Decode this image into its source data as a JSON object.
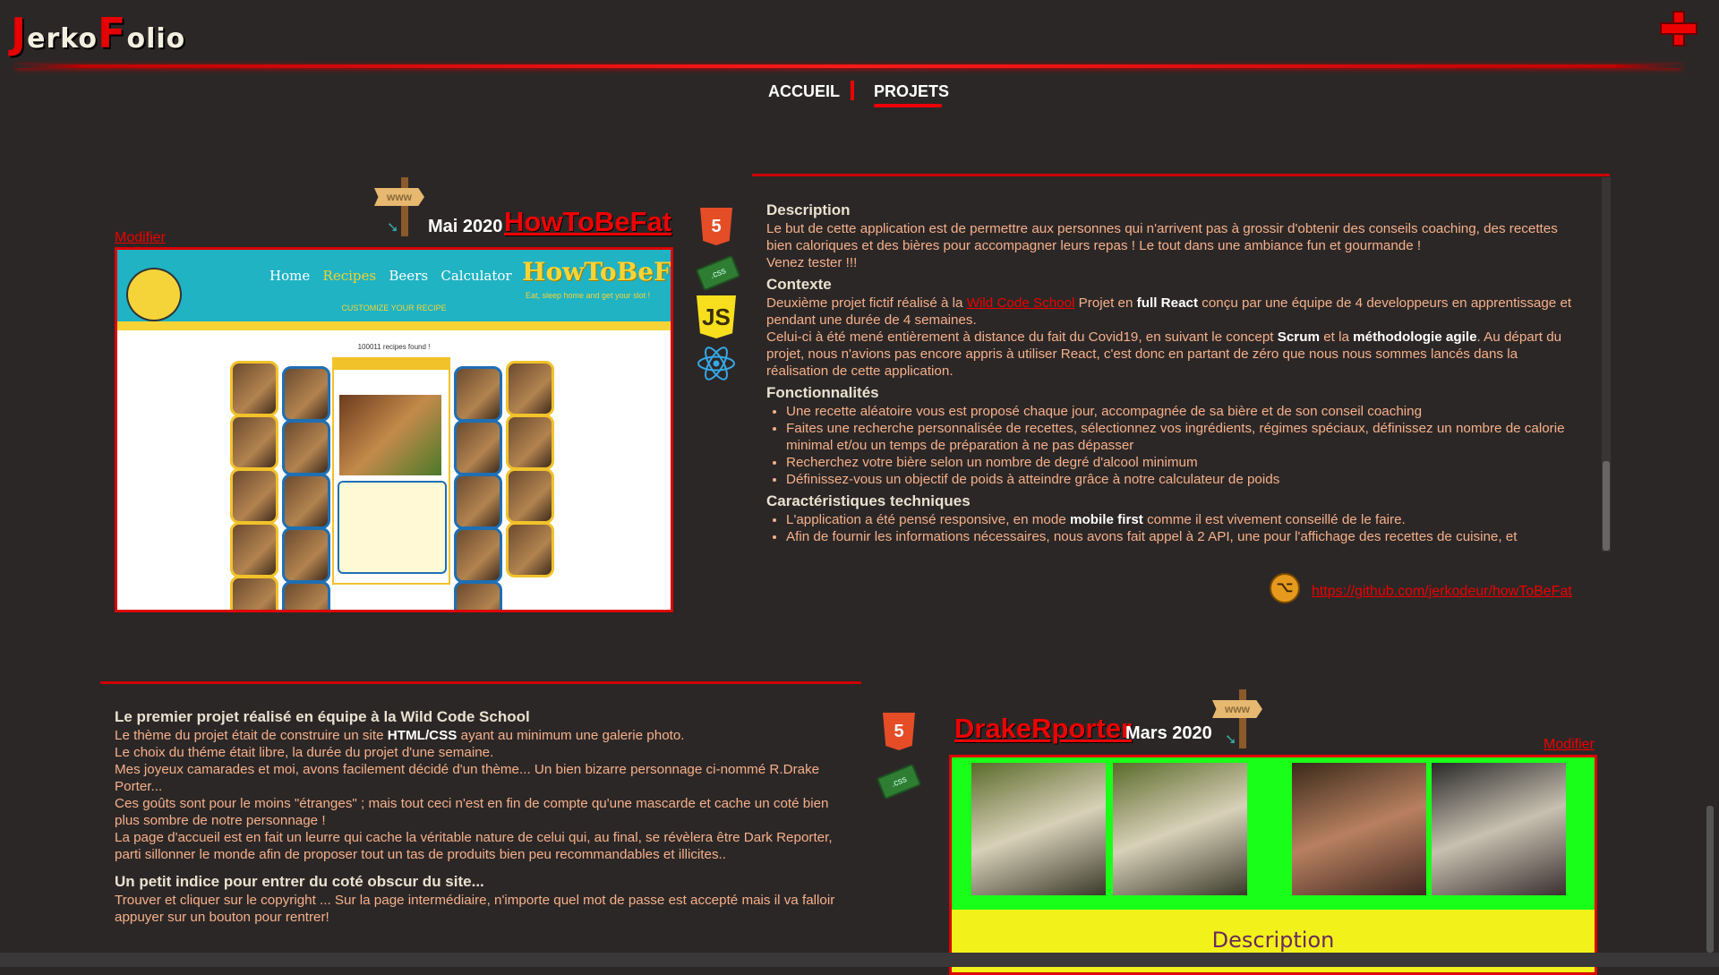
{
  "header": {
    "logo_j": "J",
    "logo_erko": "erko",
    "logo_f": "F",
    "logo_olio": "olio"
  },
  "nav": {
    "home": "ACCUEIL",
    "projects": "PROJETS"
  },
  "colors": {
    "accent": "#e00000",
    "background": "#2c2727",
    "text_orange": "#f4b08a"
  },
  "sign_text": "www",
  "project1": {
    "date": "Mai 2020",
    "title": "HowToBeFat",
    "edit_label": "Modifier",
    "screenshot": {
      "menu": [
        "Home",
        "Recipes",
        "Beers",
        "Calculator"
      ],
      "brand": "HowToBeFat",
      "tagline": "Eat, sleep home and get your slot !",
      "banner_text": "CUSTOMIZE YOUR RECIPE",
      "found": "100011 recipes found !"
    },
    "tech_icons": [
      "html5-icon",
      "css3-icon",
      "javascript-icon",
      "react-icon"
    ],
    "sections": {
      "desc_title": "Description",
      "desc_text": "Le but de cette application est de permettre aux personnes qui n'arrivent pas à grossir d'obtenir des conseils coaching, des recettes bien caloriques et des bières pour accompagner leurs repas ! Le tout dans une ambiance fun et gourmande !",
      "desc_text2": "Venez tester !!!",
      "context_title": "Contexte",
      "context_a": "Deuxième projet fictif réalisé à la ",
      "context_link": "Wild Code School",
      "context_b": " Projet en ",
      "context_bold": "full React",
      "context_c": " conçu par une équipe de 4 developpeurs en apprentissage et pendant une durée de 4 semaines.",
      "context2_a": "Celui-ci à été mené entièrement à distance du fait du Covid19, en suivant le concept ",
      "context2_bold1": "Scrum",
      "context2_b": " et la ",
      "context2_bold2": "méthodologie agile",
      "context2_c": ". Au départ du projet, nous n'avions pas encore appris à utiliser React, c'est donc en partant de zéro que nous nous sommes lancés dans la réalisation de cette application.",
      "features_title": "Fonctionnalités",
      "features": [
        "Une recette aléatoire vous est proposé chaque jour, accompagnée de sa bière et de son conseil coaching",
        "Faites une recherche personnalisée de recettes, sélectionnez vos ingrédients, régimes spéciaux, définissez un nombre de calorie minimal et/ou un temps de préparation à ne pas dépasser",
        "Recherchez votre bière selon un nombre de degré d'alcool minimum",
        "Définissez-vous un objectif de poids à atteindre grâce à notre calculateur de poids"
      ],
      "tech_title": "Caractéristiques techniques",
      "tech1_a": "L'application a été pensé responsive, en mode ",
      "tech1_bold": "mobile first",
      "tech1_b": " comme il est vivement conseillé de le faire.",
      "tech2": "Afin de fournir les informations nécessaires, nous avons fait appel à 2 API, une pour l'affichage des recettes de cuisine, et"
    },
    "github_url": "https://github.com/jerkodeur/howToBeFat"
  },
  "project2": {
    "title": "DrakeRporter",
    "date": "Mars 2020",
    "edit_label": "Modifier",
    "heading": "Le premier projet réalisé en équipe à la Wild Code School",
    "p1_a": "Le thème du projet était de construire un site ",
    "p1_bold": "HTML/CSS",
    "p1_b": " ayant au minimum une galerie photo.",
    "p2": "Le choix du théme était libre, la durée du projet d'une semaine.",
    "p3": "Mes joyeux camarades et moi, avons facilement décidé d'un thème... Un bien bizarre personnage ci-nommé R.Drake Porter...",
    "p4": "Ces goûts sont pour le moins \"étranges\" ; mais tout ceci n'est en fin de compte qu'une mascarde et cache un coté bien plus sombre de notre personnage !",
    "p5": "La page d'accueil est en fait un leurre qui cache la véritable nature de celui qui, au final, se révèlera être Dark Reporter, parti sillonner le monde afin de proposer tout un tas de produits bien peu recommandables et illicites..",
    "hint_title": "Un petit indice pour entrer du coté obscur du site...",
    "hint_text": "Trouver et cliquer sur le copyright ... Sur la page intermédiaire, n'importe quel mot de passe est accepté mais il va falloir appuyer sur un bouton pour rentrer!",
    "tech_icons": [
      "html5-icon",
      "css3-icon"
    ],
    "screenshot_heading": "Description"
  }
}
